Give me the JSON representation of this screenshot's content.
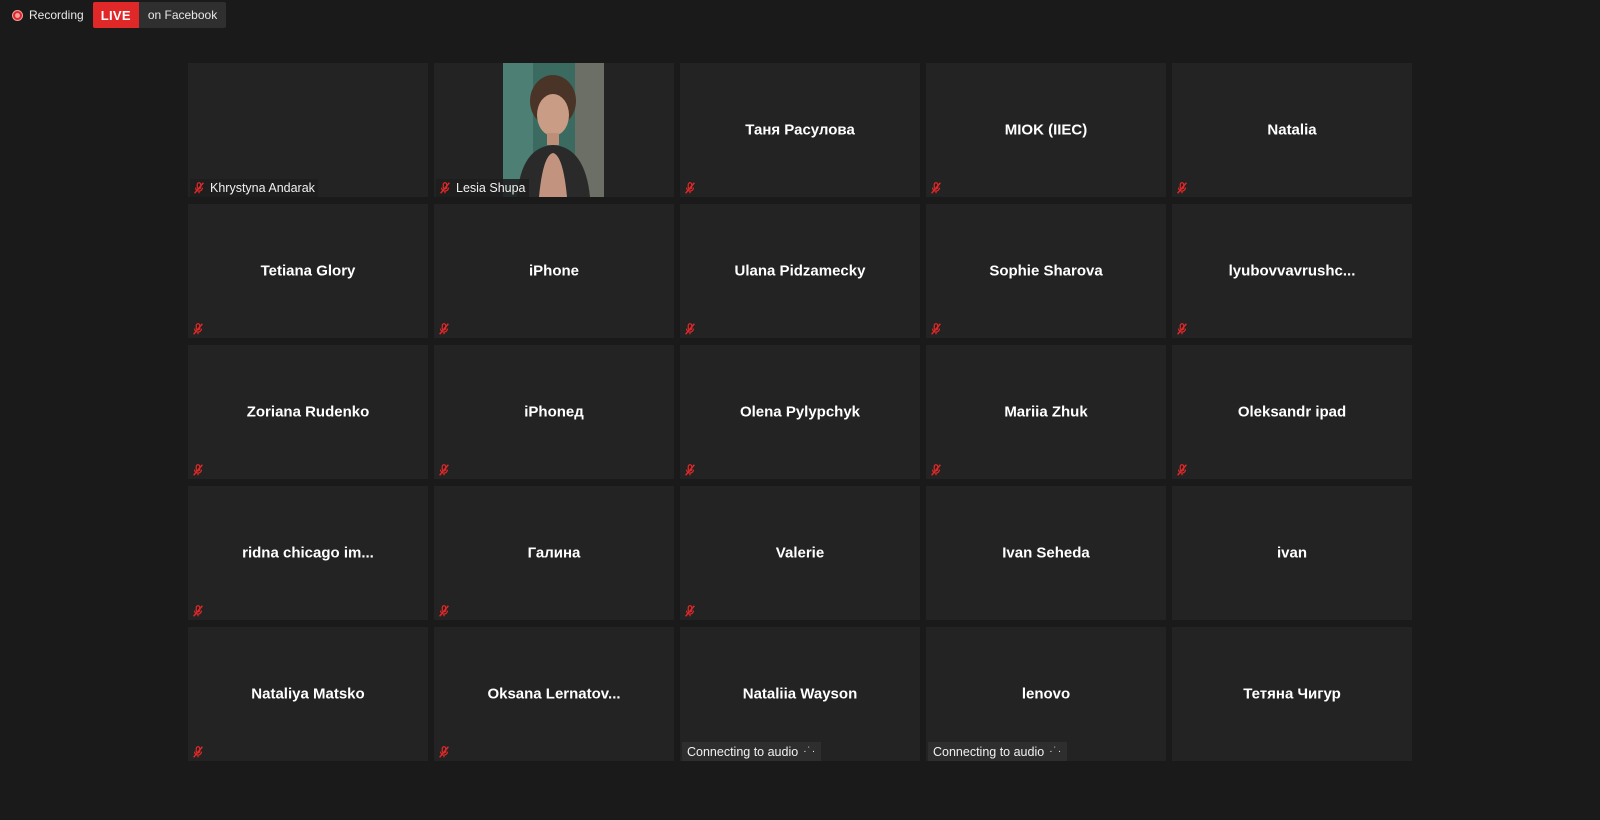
{
  "topbar": {
    "recording_label": "Recording",
    "live_label": "LIVE",
    "live_platform": "on Facebook"
  },
  "participants": [
    {
      "name": "Khrystyna Andarak",
      "muted": true,
      "status": "",
      "video": false,
      "label_style": "name"
    },
    {
      "name": "Lesia Shupa",
      "muted": true,
      "status": "",
      "video": true,
      "label_style": "name"
    },
    {
      "name": "Таня Расулова",
      "muted": true,
      "status": "",
      "video": false,
      "label_style": "center"
    },
    {
      "name": "MIOK (IIEC)",
      "muted": true,
      "status": "",
      "video": false,
      "label_style": "center"
    },
    {
      "name": "Natalia",
      "muted": true,
      "status": "",
      "video": false,
      "label_style": "center"
    },
    {
      "name": "Tetiana Glory",
      "muted": true,
      "status": "",
      "video": false,
      "label_style": "center"
    },
    {
      "name": "iPhone",
      "muted": true,
      "status": "",
      "video": false,
      "label_style": "center"
    },
    {
      "name": "Ulana Pidzamecky",
      "muted": true,
      "status": "",
      "video": false,
      "label_style": "center"
    },
    {
      "name": "Sophie Sharova",
      "muted": true,
      "status": "",
      "video": false,
      "label_style": "center"
    },
    {
      "name": "lyubovvavrushc...",
      "muted": true,
      "status": "",
      "video": false,
      "label_style": "center"
    },
    {
      "name": "Zoriana Rudenko",
      "muted": true,
      "status": "",
      "video": false,
      "label_style": "center"
    },
    {
      "name": "iPhoneд",
      "muted": true,
      "status": "",
      "video": false,
      "label_style": "center"
    },
    {
      "name": "Olena Pylypchyk",
      "muted": true,
      "status": "",
      "video": false,
      "label_style": "center"
    },
    {
      "name": "Mariia Zhuk",
      "muted": true,
      "status": "",
      "video": false,
      "label_style": "center"
    },
    {
      "name": "Oleksandr ipad",
      "muted": true,
      "status": "",
      "video": false,
      "label_style": "center"
    },
    {
      "name": "ridna chicago im...",
      "muted": true,
      "status": "",
      "video": false,
      "label_style": "center"
    },
    {
      "name": "Галина",
      "muted": true,
      "status": "",
      "video": false,
      "label_style": "center"
    },
    {
      "name": "Valerie",
      "muted": true,
      "status": "",
      "video": false,
      "label_style": "center"
    },
    {
      "name": "Ivan Seheda",
      "muted": false,
      "status": "",
      "video": false,
      "label_style": "center"
    },
    {
      "name": "ivan",
      "muted": false,
      "status": "",
      "video": false,
      "label_style": "center"
    },
    {
      "name": "Nataliya Matsko",
      "muted": true,
      "status": "",
      "video": false,
      "label_style": "center"
    },
    {
      "name": "Oksana  Lernatov...",
      "muted": true,
      "status": "",
      "video": false,
      "label_style": "center"
    },
    {
      "name": "Nataliia Wayson",
      "muted": false,
      "status": "Connecting to audio",
      "video": false,
      "label_style": "center"
    },
    {
      "name": "lenovo",
      "muted": false,
      "status": "Connecting to audio",
      "video": false,
      "label_style": "center"
    },
    {
      "name": "Тетяна Чигур",
      "muted": false,
      "status": "",
      "video": false,
      "label_style": "center"
    }
  ],
  "icons": {
    "recording": "recording-dot-icon",
    "muted_mic": "mic-muted-icon",
    "connecting": "connecting-dots-icon",
    "accent_red": "#e02828",
    "tile_bg": "#232323",
    "page_bg": "#1a1a1a"
  }
}
